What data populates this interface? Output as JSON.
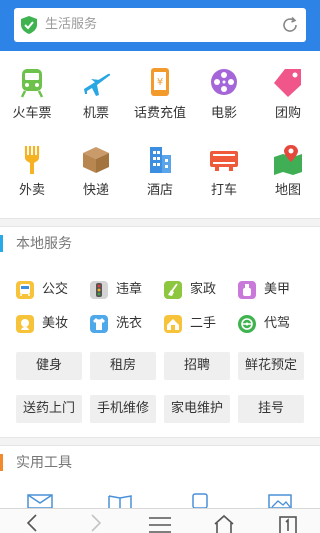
{
  "search": {
    "placeholder": "生活服务"
  },
  "top_grid": [
    {
      "label": "火车票",
      "icon": "train-icon"
    },
    {
      "label": "机票",
      "icon": "airplane-icon"
    },
    {
      "label": "话费充值",
      "icon": "phone-recharge-icon"
    },
    {
      "label": "电影",
      "icon": "film-reel-icon"
    },
    {
      "label": "团购",
      "icon": "tag-icon"
    },
    {
      "label": "外卖",
      "icon": "fork-icon"
    },
    {
      "label": "快递",
      "icon": "package-icon"
    },
    {
      "label": "酒店",
      "icon": "hotel-icon"
    },
    {
      "label": "打车",
      "icon": "taxi-icon"
    },
    {
      "label": "地图",
      "icon": "map-icon"
    }
  ],
  "local": {
    "title": "本地服务",
    "services": [
      {
        "label": "公交",
        "icon": "bus-icon"
      },
      {
        "label": "违章",
        "icon": "traffic-light-icon"
      },
      {
        "label": "家政",
        "icon": "broom-icon"
      },
      {
        "label": "美甲",
        "icon": "nail-polish-icon"
      },
      {
        "label": "美妆",
        "icon": "makeup-icon"
      },
      {
        "label": "洗衣",
        "icon": "shirt-icon"
      },
      {
        "label": "二手",
        "icon": "second-hand-icon"
      },
      {
        "label": "代驾",
        "icon": "steering-wheel-icon"
      }
    ],
    "pills": [
      "健身",
      "租房",
      "招聘",
      "鲜花预定",
      "送药上门",
      "手机维修",
      "家电维护",
      "挂号"
    ]
  },
  "tools": {
    "title": "实用工具"
  },
  "colors": {
    "header": "#2d84e6",
    "local_accent": "#29a9e8",
    "tools_accent": "#f08a2c"
  }
}
